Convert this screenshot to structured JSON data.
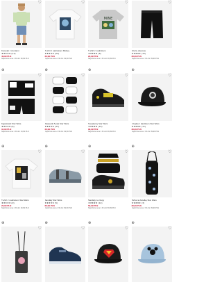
{
  "products": [
    {
      "title": "Komplet z szortami",
      "rating": "★★★★★ (12)",
      "price": "49,99 PLN",
      "note": "Najniższa cena z 30 dni: 69,99 PLN",
      "icon": "boy-outfit"
    },
    {
      "title": "T-shirt z nadrukiem Mickey",
      "rating": "★★★★★ (24)",
      "price": "29,99 PLN",
      "note": "Najniższa cena z 30 dni: 29,99 PLN",
      "icon": "white-tshirt"
    },
    {
      "title": "T-shirt z nadrukiem",
      "rating": "★★★★★ (8)",
      "price": "29,99 PLN",
      "note": "Najniższa cena z 30 dni: 39,99 PLN",
      "icon": "grey-tshirt"
    },
    {
      "title": "Szorty dresowe",
      "rating": "★★★★★ (15)",
      "price": "39,99 PLN",
      "note": "Najniższa cena z 30 dni: 39,99 PLN",
      "icon": "black-shorts"
    },
    {
      "title": "Kąpielówki Star Wars",
      "rating": "★★★★★ (6)",
      "price": "34,99 PLN",
      "note": "Najniższa cena z 30 dni: 34,99 PLN",
      "icon": "swim-shorts"
    },
    {
      "title": "Skarpetki 5 pak Star Wars",
      "rating": "★★★★★ (31)",
      "price": "29,99 PLN",
      "note": "Najniższa cena z 30 dni: 29,99 PLN",
      "icon": "socks-pack"
    },
    {
      "title": "Sneakersy Star Wars",
      "rating": "★★★★★ (19)",
      "price": "99,99 PLN",
      "note": "Najniższa cena z 30 dni: 99,99 PLN",
      "icon": "sneakers"
    },
    {
      "title": "Czapka z daszkiem Star Wars",
      "rating": "★★★★★ (11)",
      "price": "39,99 PLN",
      "note": "Najniższa cena z 30 dni: 39,99 PLN",
      "icon": "black-cap"
    },
    {
      "title": "T-shirt z nadrukiem Star Wars",
      "rating": "★★★★★ (9)",
      "price": "29,99 PLN",
      "note": "Najniższa cena z 30 dni: 29,99 PLN",
      "icon": "print-tshirt"
    },
    {
      "title": "Sandały Star Wars",
      "rating": "★★★★★ (5)",
      "price": "69,99 PLN",
      "note": "Najniższa cena z 30 dni: 69,99 PLN",
      "icon": "grey-sandals"
    },
    {
      "title": "Sandały na rzepy",
      "rating": "★★★★★ (14)",
      "price": "59,99 PLN",
      "note": "Najniższa cena z 30 dni: 59,99 PLN",
      "icon": "black-sandals"
    },
    {
      "title": "Torba na butelkę Star Wars",
      "rating": "★★★★★ (3)",
      "price": "39,99 PLN",
      "note": "Najniższa cena z 30 dni: 39,99 PLN",
      "icon": "bottle-bag"
    },
    {
      "title": "",
      "rating": "",
      "price": "",
      "note": "",
      "icon": "crossbody-bag"
    },
    {
      "title": "",
      "rating": "",
      "price": "",
      "note": "",
      "icon": "navy-sneaker"
    },
    {
      "title": "",
      "rating": "",
      "price": "",
      "note": "",
      "icon": "superman-cap"
    },
    {
      "title": "",
      "rating": "",
      "price": "",
      "note": "",
      "icon": "mickey-cap"
    }
  ],
  "icons": {
    "favorite": "♡",
    "cart": "⊕"
  },
  "colors": {
    "price": "#c8102e",
    "tile_bg": "#f3f3f3"
  }
}
